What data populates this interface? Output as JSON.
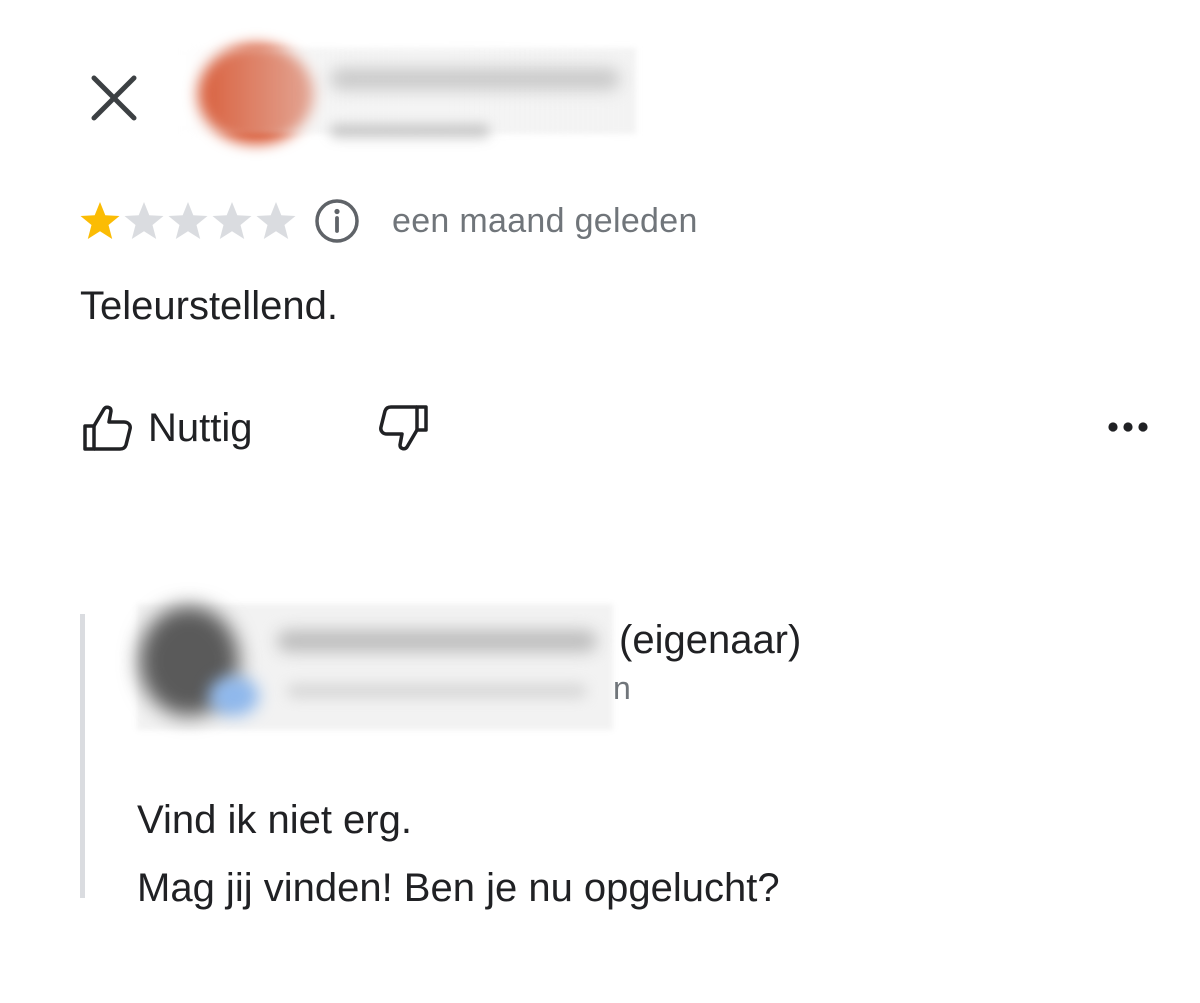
{
  "header": {
    "close_icon": "close-icon",
    "reviewer_avatar_color": "#d85530"
  },
  "review": {
    "rating": 1,
    "max_rating": 5,
    "star_filled_color": "#fbbc04",
    "star_empty_color": "#dadce0",
    "info_icon": "info-icon",
    "time": "een maand geleden",
    "text": "Teleurstellend."
  },
  "actions": {
    "like_label": "Nuttig",
    "like_icon": "thumbs-up-icon",
    "dislike_icon": "thumbs-down-icon",
    "more_icon": "more-horizontal-icon"
  },
  "owner_reply": {
    "name_suffix": "(eigenaar)",
    "sub_suffix": "n",
    "lines": [
      "Vind ik niet erg.",
      "Mag jij vinden! Ben je nu opgelucht?"
    ]
  }
}
